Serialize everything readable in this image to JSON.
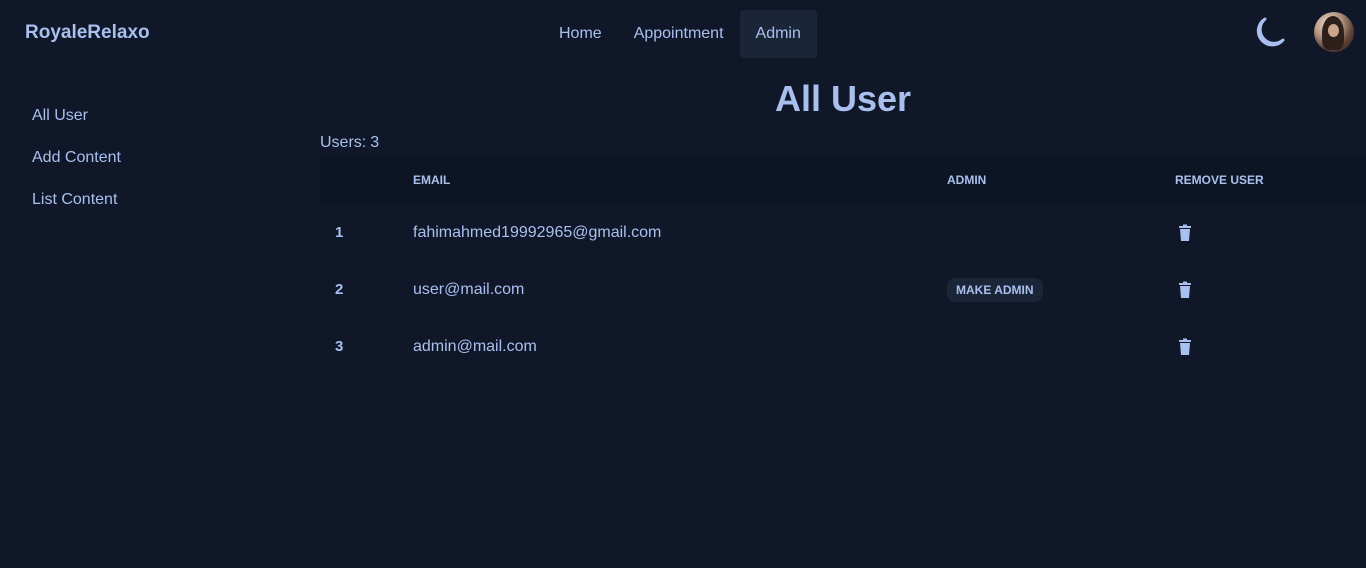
{
  "navbar": {
    "brand": "RoyaleRelaxo",
    "links": [
      "Home",
      "Appointment",
      "Admin"
    ],
    "active_link": "Admin"
  },
  "sidebar": {
    "items": [
      "All User",
      "Add Content",
      "List Content"
    ]
  },
  "page": {
    "title": "All User",
    "users_label": "Users:",
    "users_count": "3"
  },
  "table": {
    "headers": [
      "",
      "Email",
      "Admin",
      "Remove User"
    ],
    "rows": [
      {
        "index": "1",
        "email": "fahimahmed19992965@gmail.com",
        "admin_action": ""
      },
      {
        "index": "2",
        "email": "user@mail.com",
        "admin_action": "Make Admin"
      },
      {
        "index": "3",
        "email": "admin@mail.com",
        "admin_action": ""
      }
    ]
  },
  "icons": {
    "theme_toggle": "moon-icon",
    "remove": "trash-icon",
    "avatar": "user-avatar"
  },
  "colors": {
    "background": "#101728",
    "text": "#a9c0ef",
    "active_nav": "#1b2538",
    "table_header": "#0d1423"
  }
}
